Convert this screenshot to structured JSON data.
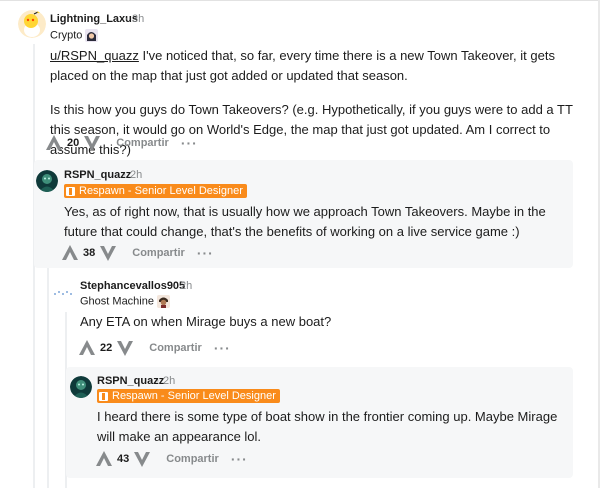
{
  "comments": [
    {
      "username": "Lightning_Laxus",
      "time": "3h",
      "flair": "Crypto",
      "mention": "u/RSPN_quazz",
      "paragraphs": [
        "I've noticed that, so far, every time there is a new Town Takeover, it gets placed on the map that just got added or updated that season.",
        "Is this how you guys do Town Takeovers? (e.g. Hypothetically, if you guys were to add a TT this season, it would go on World's Edge, the map that just got updated. Am I correct to assume this?)"
      ],
      "score": "20",
      "share_label": "Compartir"
    },
    {
      "username": "RSPN_quazz",
      "time": "2h",
      "flair": "Respawn - Senior Level Designer",
      "text": "Yes, as of right now, that is usually how we approach Town Takeovers. Maybe in the future that could change, that's the benefits of working on a live service game :)",
      "score": "38",
      "share_label": "Compartir"
    },
    {
      "username": "Stephancevallos905",
      "time": "2h",
      "flair": "Ghost Machine",
      "text": "Any ETA on when Mirage buys a new boat?",
      "score": "22",
      "share_label": "Compartir"
    },
    {
      "username": "RSPN_quazz",
      "time": "2h",
      "flair": "Respawn - Senior Level Designer",
      "text": "I heard there is some type of boat show in the frontier coming up. Maybe Mirage will make an appearance lol.",
      "score": "43",
      "share_label": "Compartir"
    }
  ],
  "separator": "·",
  "more_label": "···",
  "colors": {
    "flair_bg": "#f98b1b",
    "meta_gray": "#878a8c",
    "highlight_bg": "#f6f7f8"
  }
}
